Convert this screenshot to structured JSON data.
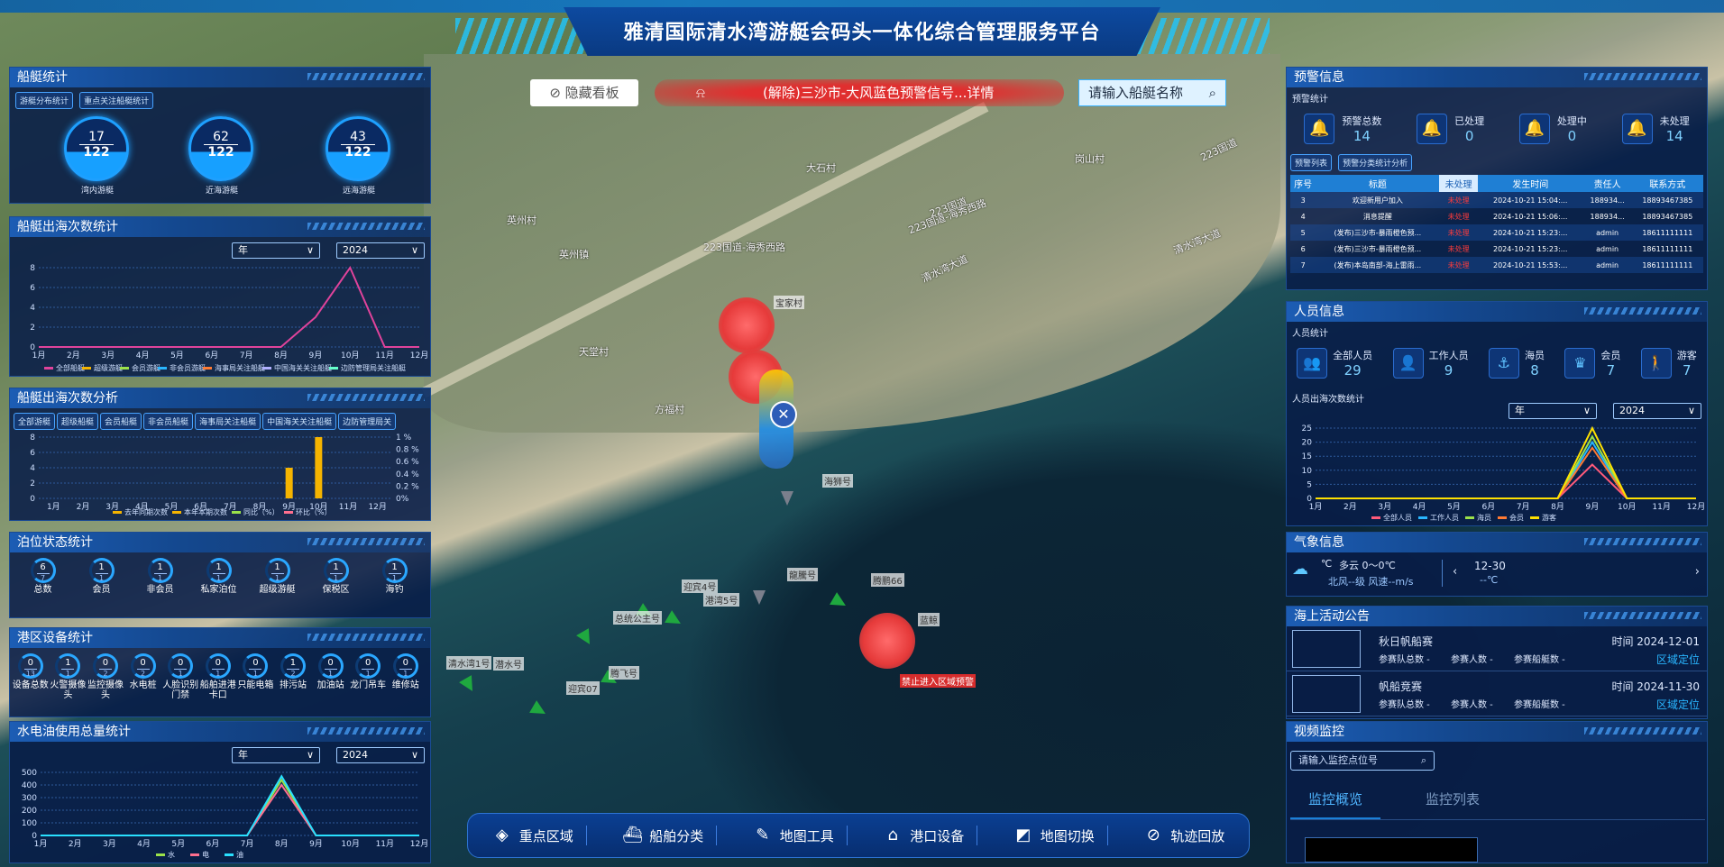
{
  "header": {
    "title": "雅清国际清水湾游艇会码头一体化综合管理服务平台"
  },
  "map_controls": {
    "hide_panel": "隐藏看板",
    "alert_banner": "(解除)三沙市-大风蓝色预警信号...详情",
    "search_placeholder": "请输入船艇名称"
  },
  "map_labels": [
    "大石村",
    "岗山村",
    "223国道-海秀西路",
    "223国道-海秀西路",
    "英州村",
    "英州镇",
    "天堂村",
    "方福村",
    "清水湾大道",
    "清水湾大道",
    "223国道",
    "223国道",
    "宝家村",
    "清水湾1号",
    "迎宾07",
    "迎宾4号",
    "港湾5号",
    "总统公主号",
    "腾鹏66",
    "龍騰号",
    "腾飞号",
    "潜水号",
    "海狮号",
    "蓝鲸",
    "禁止进入区域预警"
  ],
  "boat_stats": {
    "title": "船艇统计",
    "tabs": [
      "游艇分布统计",
      "重点关注船艇统计"
    ],
    "items": [
      {
        "num": "17",
        "den": "122",
        "label": "湾内游艇"
      },
      {
        "num": "62",
        "den": "122",
        "label": "近海游艇"
      },
      {
        "num": "43",
        "den": "122",
        "label": "远海游艇"
      }
    ]
  },
  "departure_stats": {
    "title": "船艇出海次数统计",
    "period": "年",
    "year": "2024"
  },
  "departure_analysis": {
    "title": "船艇出海次数分析",
    "tabs": [
      "全部游艇",
      "超级船艇",
      "会员船艇",
      "非会员船艇",
      "海事局关注船艇",
      "中国海关关注船艇",
      "边防管理局关"
    ],
    "legend": [
      "去年同期次数",
      "本年本期次数",
      "同比（%）",
      "环比（%）"
    ]
  },
  "berth_stats": {
    "title": "泊位状态统计",
    "items": [
      {
        "num": "6",
        "den": "7",
        "label": "总数"
      },
      {
        "num": "1",
        "den": "1",
        "label": "会员"
      },
      {
        "num": "1",
        "den": "1",
        "label": "非会员"
      },
      {
        "num": "1",
        "den": "1",
        "label": "私家泊位"
      },
      {
        "num": "1",
        "den": "1",
        "label": "超级游艇"
      },
      {
        "num": "1",
        "den": "1",
        "label": "保税区"
      },
      {
        "num": "1",
        "den": "1",
        "label": "海钓"
      }
    ]
  },
  "device_stats": {
    "title": "港区设备统计",
    "items": [
      {
        "num": "0",
        "den": "13",
        "label": "设备总数"
      },
      {
        "num": "1",
        "den": "1",
        "label": "火警摄像头"
      },
      {
        "num": "0",
        "den": "2",
        "label": "监控摄像头"
      },
      {
        "num": "0",
        "den": "2",
        "label": "水电桩"
      },
      {
        "num": "0",
        "den": "1",
        "label": "人脸识别门禁"
      },
      {
        "num": "0",
        "den": "1",
        "label": "船舶进港卡口"
      },
      {
        "num": "0",
        "den": "1",
        "label": "只能电箱"
      },
      {
        "num": "1",
        "den": "2",
        "label": "排污站"
      },
      {
        "num": "0",
        "den": "1",
        "label": "加油站"
      },
      {
        "num": "0",
        "den": "1",
        "label": "龙门吊车"
      },
      {
        "num": "0",
        "den": "1",
        "label": "维修站"
      }
    ]
  },
  "utility_stats": {
    "title": "水电油使用总量统计",
    "period": "年",
    "year": "2024",
    "legend": [
      "水",
      "电",
      "油"
    ]
  },
  "warning": {
    "title": "预警信息",
    "sub": "预警统计",
    "stats": [
      {
        "label": "预警总数",
        "value": "14",
        "color": "#29b6ff"
      },
      {
        "label": "已处理",
        "value": "0",
        "color": "#2ecc40"
      },
      {
        "label": "处理中",
        "value": "0",
        "color": "#f5c400"
      },
      {
        "label": "未处理",
        "value": "14",
        "color": "#ff3b3b"
      }
    ],
    "tabs": [
      "预警列表",
      "预警分类统计分析"
    ],
    "columns": [
      "序号",
      "标题",
      "未处理",
      "发生时间",
      "责任人",
      "联系方式"
    ],
    "rows": [
      [
        "3",
        "欢迎新用户加入",
        "未处理",
        "2024-10-21 15:04:...",
        "188934...",
        "18893467385"
      ],
      [
        "4",
        "消息提醒",
        "未处理",
        "2024-10-21 15:06:...",
        "188934...",
        "18893467385"
      ],
      [
        "5",
        "(发布)三沙市-暴雨橙色预...",
        "未处理",
        "2024-10-21 15:23:...",
        "admin",
        "18611111111"
      ],
      [
        "6",
        "(发布)三沙市-暴雨橙色预...",
        "未处理",
        "2024-10-21 15:23:...",
        "admin",
        "18611111111"
      ],
      [
        "7",
        "(发布)本岛南部-海上雷雨...",
        "未处理",
        "2024-10-21 15:53:...",
        "admin",
        "18611111111"
      ]
    ]
  },
  "personnel": {
    "title": "人员信息",
    "sub": "人员统计",
    "items": [
      {
        "label": "全部人员",
        "value": "29"
      },
      {
        "label": "工作人员",
        "value": "9"
      },
      {
        "label": "海员",
        "value": "8"
      },
      {
        "label": "会员",
        "value": "7"
      },
      {
        "label": "游客",
        "value": "7"
      }
    ],
    "trend_title": "人员出海次数统计",
    "period": "年",
    "year": "2024",
    "legend": [
      "全部人员",
      "工作人员",
      "海员",
      "会员",
      "游客"
    ]
  },
  "weather": {
    "title": "气象信息",
    "unit": "℃",
    "desc": "多云 0～0℃",
    "wind": "北风--级 风速--m/s",
    "date": "12-30",
    "temp": "--℃"
  },
  "notices": {
    "title": "海上活动公告",
    "items": [
      {
        "name": "秋日帆船赛",
        "time": "时间 2024-12-01",
        "f1": "参赛队总数 -",
        "f2": "参赛人数 -",
        "f3": "参赛船艇数 -",
        "link": "区域定位"
      },
      {
        "name": "帆船竞赛",
        "time": "时间 2024-11-30",
        "f1": "参赛队总数 -",
        "f2": "参赛人数 -",
        "f3": "参赛船艇数 -",
        "link": "区域定位"
      }
    ]
  },
  "video": {
    "title": "视频监控",
    "search_placeholder": "请输入监控点位号",
    "tabs": [
      "监控概览",
      "监控列表"
    ]
  },
  "toolbar": {
    "items": [
      "重点区域",
      "船舶分类",
      "地图工具",
      "港口设备",
      "地图切换",
      "轨迹回放"
    ]
  },
  "charts": {
    "departures": {
      "type": "line",
      "categories": [
        "1月",
        "2月",
        "3月",
        "4月",
        "5月",
        "6月",
        "7月",
        "8月",
        "9月",
        "10月",
        "11月",
        "12月"
      ],
      "ylim": [
        0,
        8
      ],
      "yticks": [
        "0",
        "2",
        "4",
        "6",
        "8"
      ],
      "series": [
        {
          "name": "全部船艇",
          "color": "#e0439b",
          "values": [
            0,
            0,
            0,
            0,
            0,
            0,
            0,
            0,
            3,
            8,
            0,
            0
          ]
        }
      ],
      "legend": [
        "全部船艇",
        "超级游艇",
        "会员游艇",
        "非会员游艇",
        "海事局关注船艇",
        "中国海关关注船艇",
        "边防管理局关注船艇"
      ]
    },
    "analysis": {
      "type": "bar",
      "categories": [
        "1月",
        "2月",
        "3月",
        "4月",
        "5月",
        "6月",
        "7月",
        "8月",
        "9月",
        "10月",
        "11月",
        "12月"
      ],
      "ylim": [
        0,
        8
      ],
      "yticks": [
        "0",
        "2",
        "4",
        "6",
        "8"
      ],
      "y2ticks": [
        "0%",
        "0.2 %",
        "0.4 %",
        "0.6 %",
        "0.8 %",
        "1 %"
      ],
      "series": [
        {
          "name": "本年本期次数",
          "color": "#f5b400",
          "values": [
            0,
            0,
            0,
            0,
            0,
            0,
            0,
            0,
            4,
            8,
            0,
            0
          ]
        }
      ]
    },
    "personnel": {
      "type": "line",
      "categories": [
        "1月",
        "2月",
        "3月",
        "4月",
        "5月",
        "6月",
        "7月",
        "8月",
        "9月",
        "10月",
        "11月",
        "12月"
      ],
      "ylim": [
        0,
        25
      ],
      "yticks": [
        "0",
        "5",
        "10",
        "15",
        "20",
        "25"
      ],
      "series": [
        {
          "name": "全部人员",
          "color": "#ff5a7a",
          "values": [
            0,
            0,
            0,
            0,
            0,
            0,
            0,
            0,
            12,
            0,
            0,
            0
          ]
        },
        {
          "name": "工作人员",
          "color": "#29b6ff",
          "values": [
            0,
            0,
            0,
            0,
            0,
            0,
            0,
            0,
            20,
            0,
            0,
            0
          ]
        },
        {
          "name": "海员",
          "color": "#9be24a",
          "values": [
            0,
            0,
            0,
            0,
            0,
            0,
            0,
            0,
            22,
            0,
            0,
            0
          ]
        },
        {
          "name": "会员",
          "color": "#ff7a33",
          "values": [
            0,
            0,
            0,
            0,
            0,
            0,
            0,
            0,
            18,
            0,
            0,
            0
          ]
        },
        {
          "name": "游客",
          "color": "#ffe100",
          "values": [
            0,
            0,
            0,
            0,
            0,
            0,
            0,
            0,
            25,
            0,
            0,
            0
          ]
        }
      ]
    },
    "utility": {
      "type": "line",
      "categories": [
        "1月",
        "2月",
        "3月",
        "4月",
        "5月",
        "6月",
        "7月",
        "8月",
        "9月",
        "10月",
        "11月",
        "12月"
      ],
      "ylim": [
        0,
        500
      ],
      "yticks": [
        "0",
        "100",
        "200",
        "300",
        "400",
        "500"
      ],
      "series": [
        {
          "name": "水",
          "color": "#9be24a",
          "values": [
            0,
            0,
            0,
            0,
            0,
            0,
            0,
            440,
            0,
            0,
            0,
            0
          ]
        },
        {
          "name": "电",
          "color": "#ff6f8f",
          "values": [
            0,
            0,
            0,
            0,
            0,
            0,
            0,
            400,
            0,
            0,
            0,
            0
          ]
        },
        {
          "name": "油",
          "color": "#29e0ff",
          "values": [
            0,
            0,
            0,
            0,
            0,
            0,
            0,
            470,
            0,
            0,
            0,
            0
          ]
        }
      ]
    }
  }
}
